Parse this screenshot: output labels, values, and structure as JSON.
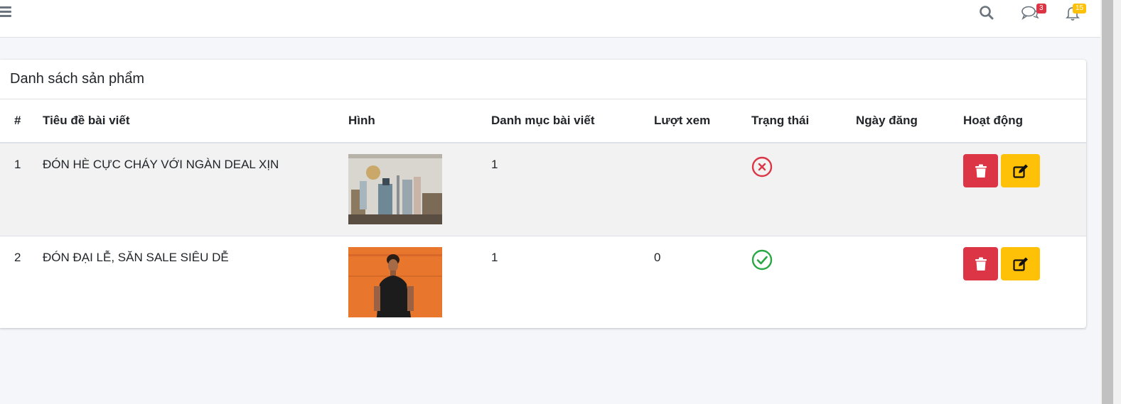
{
  "topbar": {
    "messages_badge": "3",
    "notifications_badge": "15",
    "icons": [
      "menu-icon",
      "search-icon",
      "chat-icon",
      "bell-icon"
    ]
  },
  "card": {
    "title": "Danh sách sản phẩm"
  },
  "table": {
    "headers": [
      "#",
      "Tiêu đề bài viết",
      "Hình",
      "Danh mục bài viết",
      "Lượt xem",
      "Trạng thái",
      "Ngày đăng",
      "Hoạt động"
    ],
    "rows": [
      {
        "index": "1",
        "title": "ĐÓN HÈ CỰC CHÁY VỚI NGÀN DEAL XỊN",
        "category": "1",
        "views": "",
        "status": "inactive",
        "date": ""
      },
      {
        "index": "2",
        "title": "ĐÓN ĐẠI LỄ, SĂN SALE SIÊU DỄ",
        "category": "1",
        "views": "0",
        "status": "active",
        "date": ""
      }
    ]
  },
  "colors": {
    "danger": "#dc3545",
    "warning": "#ffc107",
    "success": "#28a745"
  }
}
